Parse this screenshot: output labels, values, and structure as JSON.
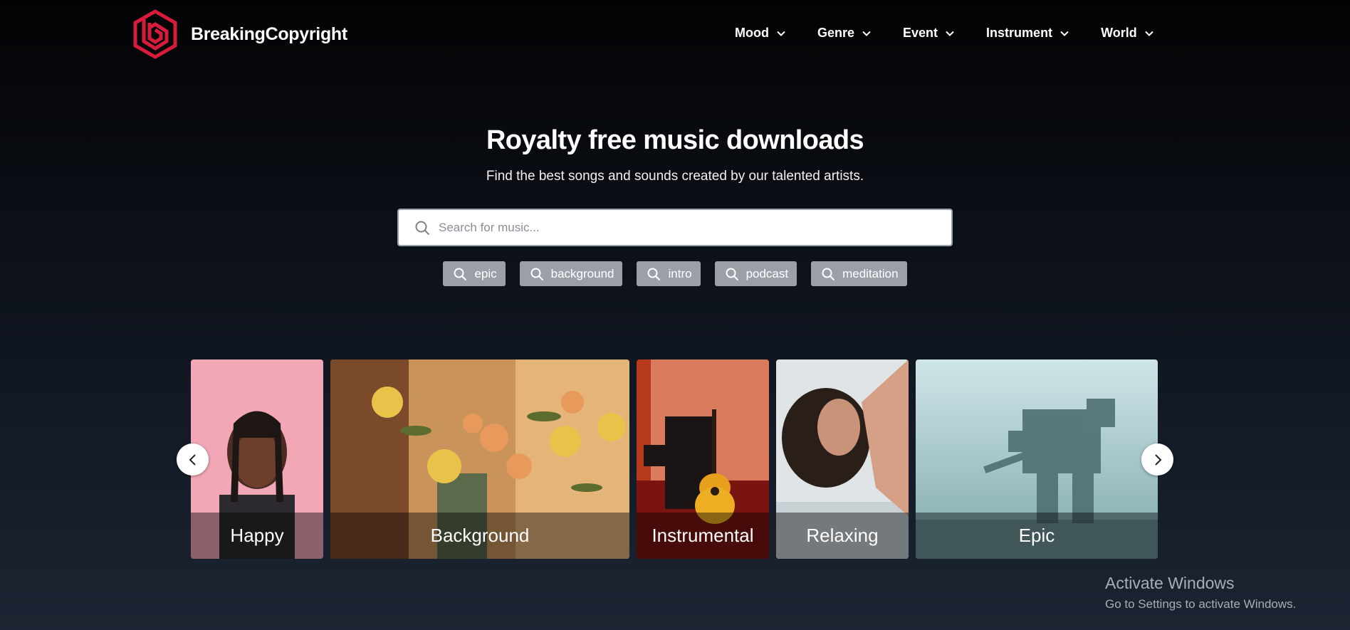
{
  "brand": {
    "name": "BreakingCopyright",
    "logo_icon": "hexagon-b-logo-icon",
    "accent": "#d81b3c"
  },
  "nav": [
    {
      "label": "Mood"
    },
    {
      "label": "Genre"
    },
    {
      "label": "Event"
    },
    {
      "label": "Instrument"
    },
    {
      "label": "World"
    }
  ],
  "hero": {
    "title": "Royalty free music downloads",
    "subtitle": "Find the best songs and sounds created by our talented artists."
  },
  "search": {
    "placeholder": "Search for music...",
    "value": ""
  },
  "tags": [
    {
      "label": "epic"
    },
    {
      "label": "background"
    },
    {
      "label": "intro"
    },
    {
      "label": "podcast"
    },
    {
      "label": "meditation"
    }
  ],
  "categories": [
    {
      "label": "Happy"
    },
    {
      "label": "Background"
    },
    {
      "label": "Instrumental"
    },
    {
      "label": "Relaxing"
    },
    {
      "label": "Epic"
    }
  ],
  "windows_watermark": {
    "title": "Activate Windows",
    "subtitle": "Go to Settings to activate Windows."
  }
}
